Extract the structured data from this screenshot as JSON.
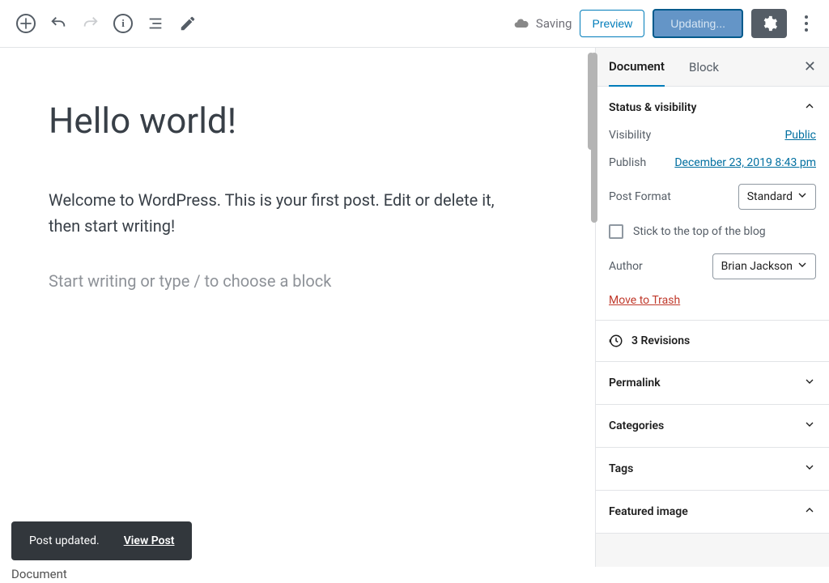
{
  "toolbar": {
    "saving_label": "Saving",
    "preview_label": "Preview",
    "update_label": "Updating..."
  },
  "editor": {
    "title": "Hello world!",
    "body": "Welcome to WordPress. This is your first post. Edit or delete it, then start writing!",
    "prompt": "Start writing or type / to choose a block"
  },
  "sidebar": {
    "tabs": {
      "document": "Document",
      "block": "Block"
    },
    "panels": {
      "status_header": "Status & visibility",
      "visibility_label": "Visibility",
      "visibility_value": "Public",
      "publish_label": "Publish",
      "publish_value": "December 23, 2019 8:43 pm",
      "format_label": "Post Format",
      "format_value": "Standard",
      "stick_label": "Stick to the top of the blog",
      "author_label": "Author",
      "author_value": "Brian Jackson",
      "trash_label": "Move to Trash",
      "revisions_label": "3 Revisions",
      "permalink": "Permalink",
      "categories": "Categories",
      "tags": "Tags",
      "featured_image": "Featured image"
    }
  },
  "snackbar": {
    "message": "Post updated.",
    "action": "View Post"
  },
  "breadcrumb": "Document"
}
